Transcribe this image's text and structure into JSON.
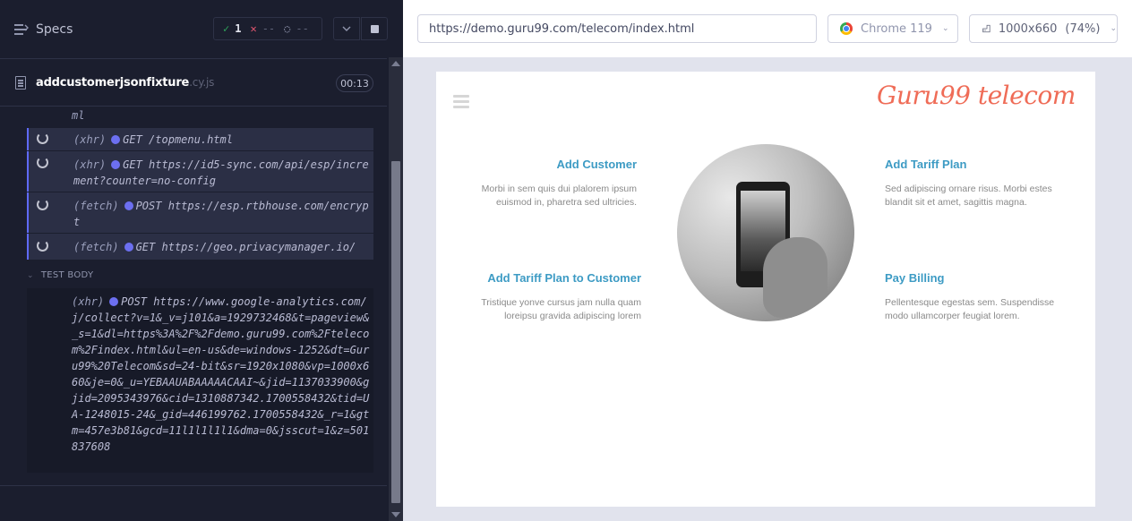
{
  "reporter": {
    "specs_label": "Specs",
    "stats": {
      "passed": "1",
      "failed": "--",
      "pending": "--"
    },
    "spec": {
      "name": "addcustomerjsonfixture",
      "ext": ".cy.js",
      "duration": "00:13"
    },
    "log_cut": "ml",
    "commands": [
      {
        "kind": "(xhr)",
        "method": "GET",
        "url": "/topmenu.html"
      },
      {
        "kind": "(xhr)",
        "method": "GET",
        "url": "https://id5-sync.com/api/esp/increment?counter=no-config"
      },
      {
        "kind": "(fetch)",
        "method": "POST",
        "url": "https://esp.rtbhouse.com/encrypt"
      },
      {
        "kind": "(fetch)",
        "method": "GET",
        "url": "https://geo.privacymanager.io/"
      }
    ],
    "test_body_label": "TEST BODY",
    "body_command": {
      "kind": "(xhr)",
      "method": "POST",
      "url": "https://www.google-analytics.com/j/collect?v=1&_v=j101&a=1929732468&t=pageview&_s=1&dl=https%3A%2F%2Fdemo.guru99.com%2Ftelecom%2Findex.html&ul=en-us&de=windows-1252&dt=Guru99%20Telecom&sd=24-bit&sr=1920x1080&vp=1000x660&je=0&_u=YEBAAUABAAAAACAAI~&jid=1137033900&gjid=2095343976&cid=1310887342.1700558432&tid=UA-1248015-24&_gid=446199762.1700558432&_r=1&gtm=457e3b81&gcd=11l1l1l1l1&dma=0&jsscut=1&z=501837608"
    }
  },
  "aut": {
    "url": "https://demo.guru99.com/telecom/index.html",
    "browser": "Chrome 119",
    "viewport": "1000x660",
    "zoom": "(74%)",
    "site": {
      "logo": "Guru99 telecom",
      "features": [
        {
          "title": "Add Customer",
          "text": "Morbi in sem quis dui plalorem ipsum euismod in, pharetra sed ultricies."
        },
        {
          "title": "Add Tariff Plan",
          "text": "Sed adipiscing ornare risus. Morbi estes blandit sit et amet, sagittis magna."
        },
        {
          "title": "Add Tariff Plan to Customer",
          "text": "Tristique yonve cursus jam nulla quam loreipsu gravida adipiscing lorem"
        },
        {
          "title": "Pay Billing",
          "text": "Pellentesque egestas sem. Suspendisse modo ullamcorper feugiat lorem."
        }
      ]
    }
  },
  "icons": [
    "specs-menu-icon",
    "check-icon",
    "x-icon",
    "pending-icon",
    "chevron-down-icon",
    "stop-icon",
    "file-icon",
    "spinner-icon",
    "chrome-icon",
    "viewport-icon",
    "hamburger-icon"
  ]
}
